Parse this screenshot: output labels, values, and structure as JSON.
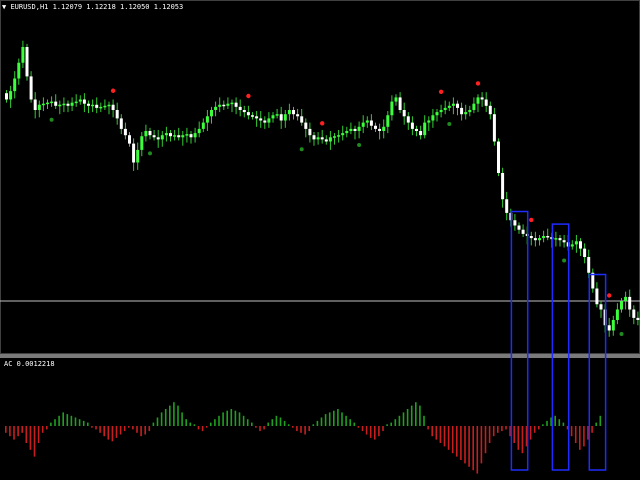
{
  "main_chart": {
    "symbol_label": "EURUSD,H1  1.12079 1.12218 1.12050 1.12053",
    "dropdown_glyph": "▼",
    "colors": {
      "bull": "#3cff3c",
      "bear": "#ffffff",
      "wick": "#33cc33",
      "horizontal_line": "#c0c0c0"
    }
  },
  "indicator": {
    "label": "AC 0.0012218",
    "colors": {
      "positive": "#1fa01f",
      "negative": "#c81e1e"
    }
  },
  "highlight_color": "#1e2cff",
  "signal_colors": {
    "sell": "#ff2020",
    "buy": "#1f8a1f"
  },
  "chart_data": {
    "type": "candlestick",
    "values": [
      90,
      82,
      70,
      55,
      40,
      68,
      90,
      100,
      95,
      94,
      93,
      92,
      96,
      95,
      94,
      96,
      93,
      92,
      90,
      94,
      96,
      95,
      98,
      97,
      96,
      95,
      100,
      108,
      118,
      124,
      132,
      150,
      138,
      125,
      120,
      124,
      126,
      128,
      124,
      122,
      125,
      124,
      126,
      124,
      123,
      126,
      122,
      118,
      112,
      106,
      100,
      97,
      95,
      96,
      94,
      93,
      97,
      100,
      102,
      105,
      106,
      108,
      110,
      112,
      108,
      105,
      104,
      110,
      104,
      100,
      104,
      106,
      112,
      118,
      124,
      128,
      126,
      128,
      130,
      126,
      125,
      124,
      122,
      120,
      118,
      120,
      116,
      112,
      110,
      115,
      118,
      120,
      116,
      105,
      92,
      88,
      100,
      106,
      112,
      118,
      120,
      124,
      112,
      110,
      105,
      102,
      100,
      98,
      96,
      94,
      98,
      104,
      102,
      100,
      94,
      88,
      90,
      96,
      104,
      130,
      160,
      185,
      198,
      205,
      210,
      214,
      218,
      220,
      222,
      224,
      222,
      220,
      221,
      223,
      222,
      224,
      226,
      230,
      228,
      225,
      232,
      240,
      255,
      270,
      285,
      290,
      305,
      310,
      300,
      290,
      282,
      278,
      290,
      298,
      300
    ],
    "sell_signals": [
      26,
      59,
      77,
      106,
      115,
      128,
      147
    ],
    "buy_signals": [
      11,
      35,
      72,
      86,
      108,
      136,
      150
    ],
    "highlight_boxes": [
      [
        124,
        127
      ],
      [
        134,
        137
      ],
      [
        143,
        146
      ]
    ],
    "ac_histogram": [
      -4,
      -6,
      -8,
      -6,
      -4,
      -10,
      -14,
      -18,
      -10,
      -4,
      -2,
      2,
      4,
      6,
      8,
      7,
      6,
      5,
      4,
      3,
      2,
      -1,
      -2,
      -4,
      -6,
      -8,
      -9,
      -7,
      -5,
      -3,
      -1,
      -2,
      -4,
      -6,
      -5,
      -3,
      2,
      5,
      8,
      10,
      12,
      14,
      12,
      8,
      4,
      2,
      1,
      -2,
      -3,
      -1,
      2,
      4,
      6,
      8,
      9,
      10,
      9,
      8,
      6,
      4,
      2,
      -1,
      -3,
      -2,
      2,
      4,
      6,
      5,
      3,
      1,
      -1,
      -3,
      -4,
      -5,
      -3,
      1,
      3,
      5,
      7,
      8,
      9,
      10,
      8,
      6,
      4,
      2,
      -1,
      -3,
      -5,
      -7,
      -8,
      -6,
      -3,
      1,
      2,
      4,
      6,
      8,
      10,
      12,
      14,
      12,
      6,
      -2,
      -6,
      -8,
      -10,
      -12,
      -14,
      -16,
      -18,
      -20,
      -22,
      -24,
      -26,
      -28,
      -22,
      -16,
      -10,
      -6,
      -4,
      -3,
      -2,
      -6,
      -10,
      -14,
      -16,
      -12,
      -8,
      -4,
      -2,
      1,
      3,
      5,
      6,
      4,
      2,
      -2,
      -6,
      -10,
      -14,
      -12,
      -8,
      -4,
      2,
      6
    ]
  }
}
